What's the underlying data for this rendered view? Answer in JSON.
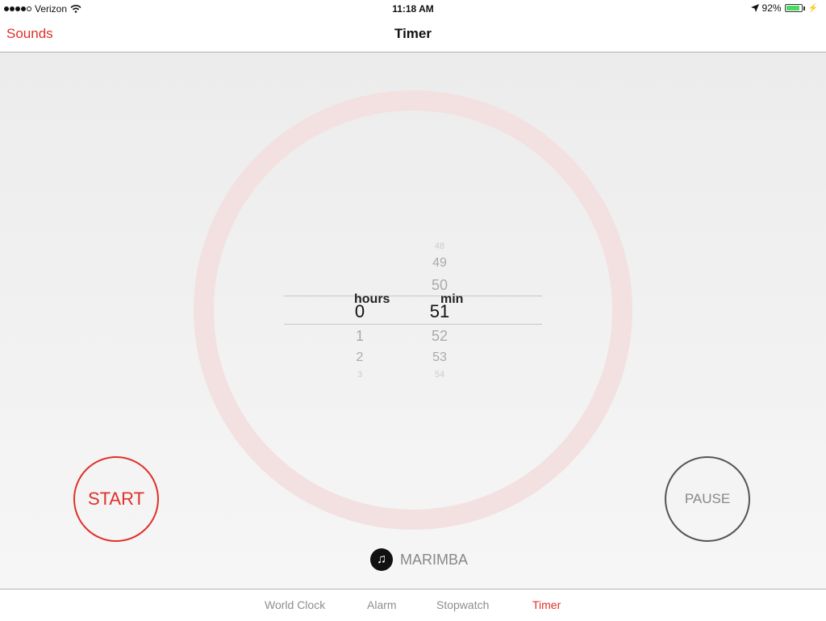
{
  "status_bar": {
    "carrier": "Verizon",
    "time": "11:18 AM",
    "battery_text": "92%",
    "battery_level": 0.92
  },
  "nav": {
    "left_label": "Sounds",
    "title": "Timer"
  },
  "picker": {
    "hours": {
      "selected": "0",
      "below": [
        "1",
        "2",
        "3"
      ],
      "unit": "hours"
    },
    "minutes": {
      "above": [
        "48",
        "49",
        "50"
      ],
      "selected": "51",
      "below": [
        "52",
        "53",
        "54"
      ],
      "unit": "min"
    }
  },
  "buttons": {
    "start": "START",
    "pause": "PAUSE"
  },
  "sound": {
    "label": "MARIMBA"
  },
  "tabs": [
    {
      "label": "World Clock",
      "active": false
    },
    {
      "label": "Alarm",
      "active": false
    },
    {
      "label": "Stopwatch",
      "active": false
    },
    {
      "label": "Timer",
      "active": true
    }
  ],
  "colors": {
    "accent": "#e0302a",
    "ring": "#f3e1e1",
    "battery": "#4cd964"
  }
}
